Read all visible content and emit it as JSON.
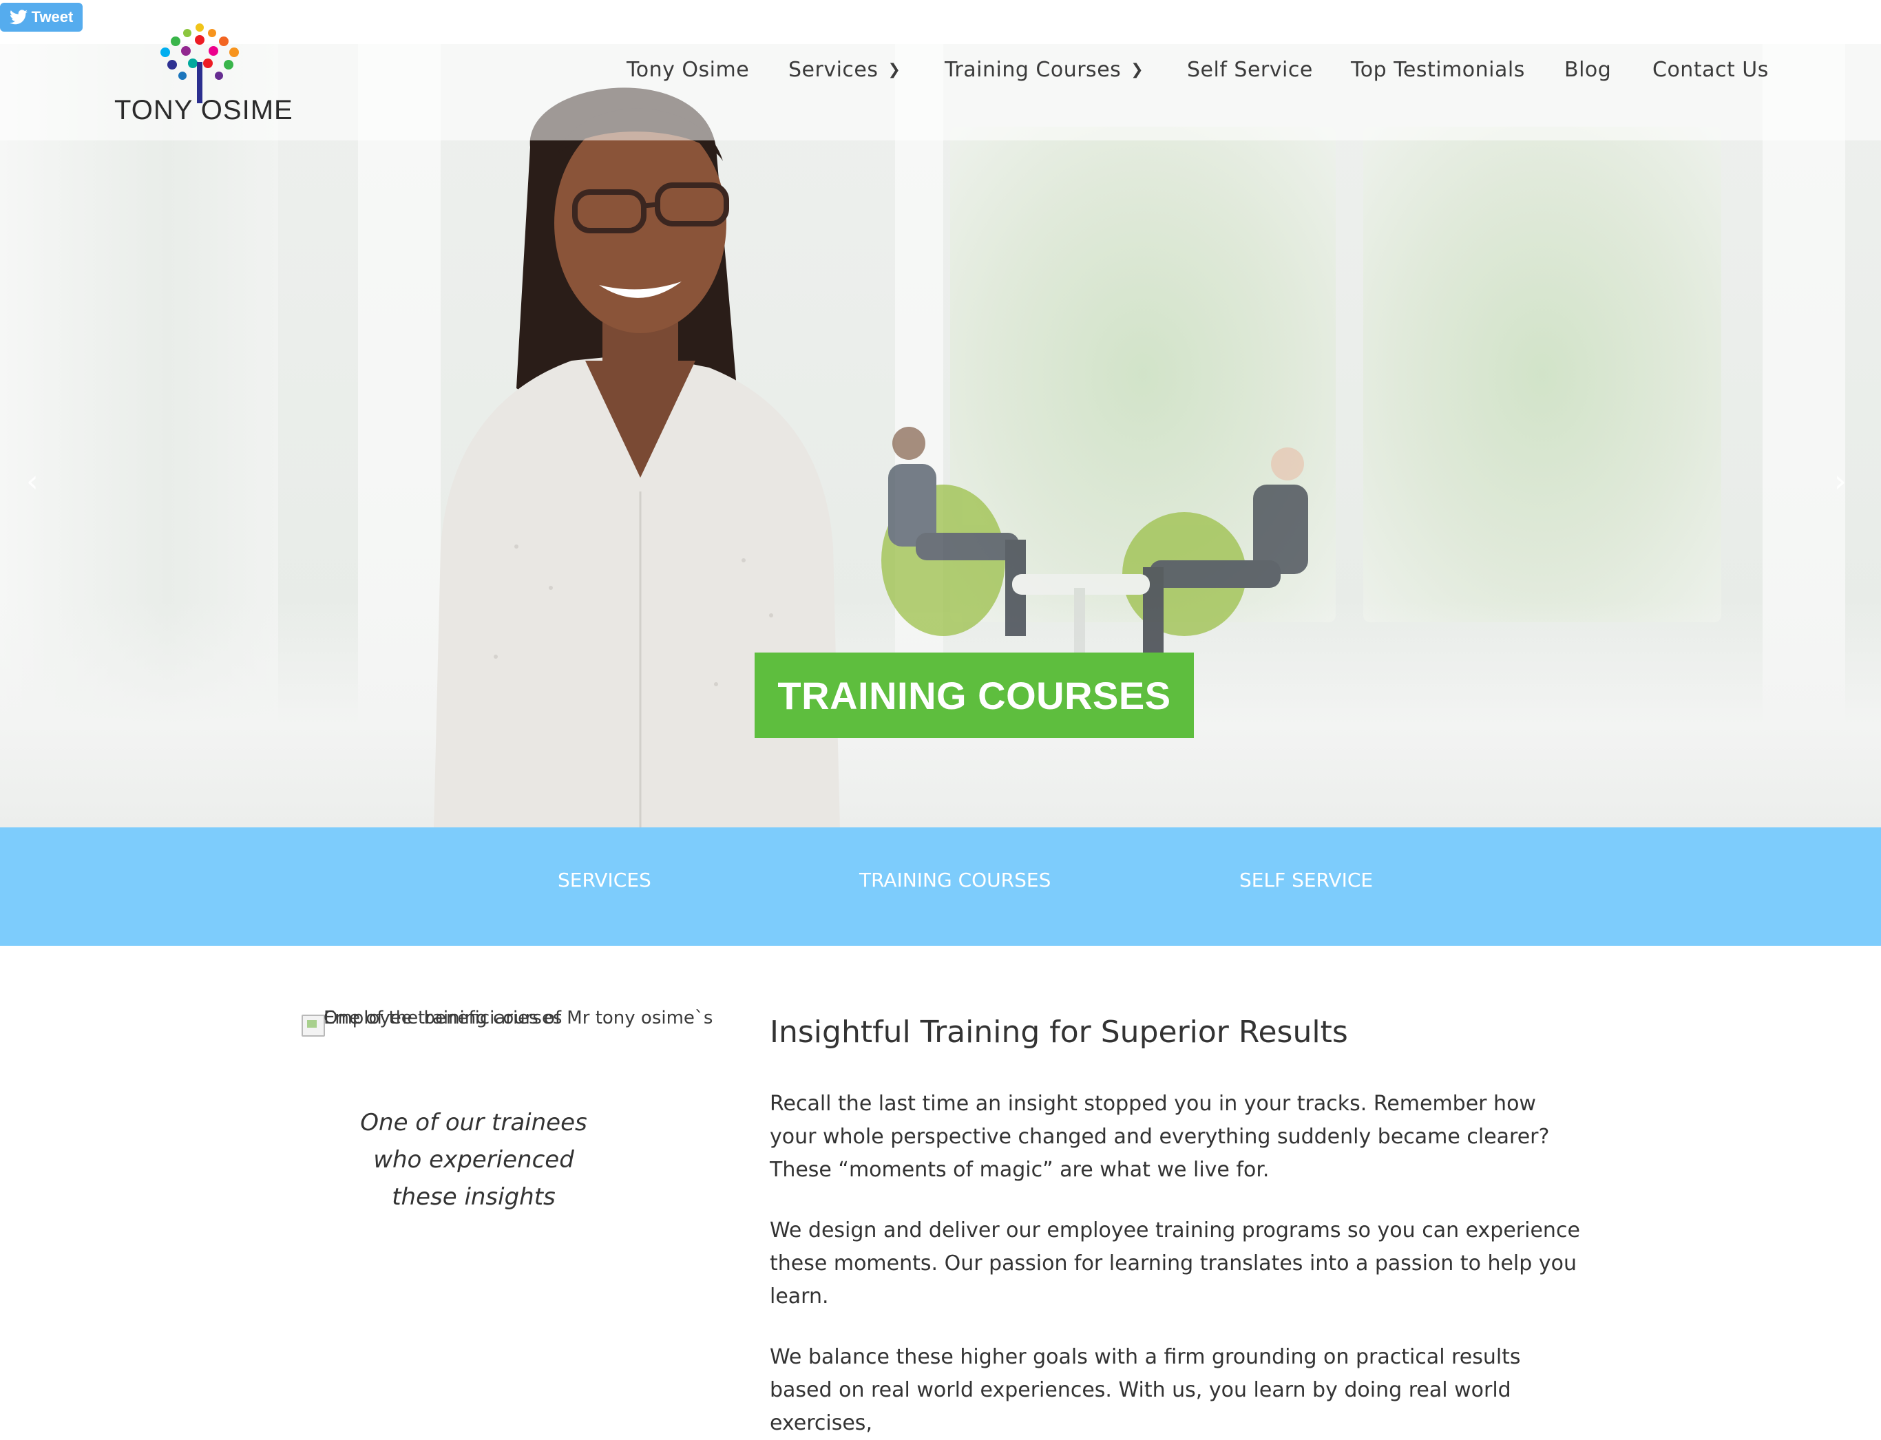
{
  "tweet": {
    "label": "Tweet"
  },
  "logo": {
    "text": "TONY OSIME"
  },
  "nav": {
    "items": [
      {
        "label": "Tony Osime"
      },
      {
        "label": "Services"
      },
      {
        "label": "Training Courses"
      },
      {
        "label": "Self Service"
      },
      {
        "label": "Top Testimonials"
      },
      {
        "label": "Blog"
      },
      {
        "label": "Contact Us"
      }
    ]
  },
  "hero": {
    "title": "TRAINING COURSES"
  },
  "subnav": {
    "items": [
      {
        "label": "SERVICES"
      },
      {
        "label": "TRAINING COURSES"
      },
      {
        "label": "SELF SERVICE"
      }
    ]
  },
  "content": {
    "image_alt_1": "Employee training courses",
    "image_alt_2": "One of the beneficiaries of Mr tony osime`s",
    "caption": "One of our trainees who experienced these insights",
    "heading": "Insightful Training for Superior Results",
    "paragraphs": [
      "Recall the last time an insight stopped you in your tracks. Remember how your whole perspective changed and everything suddenly became clearer? These “moments of magic” are what we live for.",
      "We design and deliver our employee training programs so you can experience these moments. Our passion for learning translates into a passion to help you learn.",
      "We balance these higher goals with a firm grounding on practical results based on real world experiences. With us, you learn by doing real world exercises,"
    ]
  },
  "colors": {
    "accent_green": "#5ebe3e",
    "subnav_blue": "#7dccfc",
    "tweet_blue": "#55acee"
  }
}
